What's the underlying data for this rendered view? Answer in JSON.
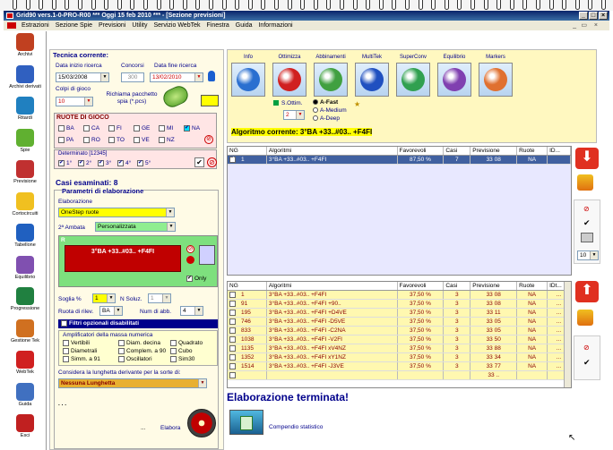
{
  "window": {
    "title": "Grid90 vers.1-0-PRO-R00  ***  Oggi 15 feb 2010  ***  - [Sezione previsioni]"
  },
  "menu": [
    "Estrazioni",
    "Sezione Spie",
    "Previsioni",
    "Utility",
    "Servizio WebTek",
    "Finestra",
    "Guida",
    "Informazioni"
  ],
  "sidebar": [
    {
      "label": "Archivi",
      "icon": "book-icon"
    },
    {
      "label": "Archivi derivati",
      "icon": "blue-book-icon"
    },
    {
      "label": "Ritardi",
      "icon": "clock-icon"
    },
    {
      "label": "Spie",
      "icon": "tube-icon"
    },
    {
      "label": "Previsione",
      "icon": "clipboard-icon"
    },
    {
      "label": "Cortocircuiti",
      "icon": "bulb-icon"
    },
    {
      "label": "Tabellone",
      "icon": "calendar-icon"
    },
    {
      "label": "Equilibrio",
      "icon": "scale-icon"
    },
    {
      "label": "Progressione",
      "icon": "dollar-icon"
    },
    {
      "label": "Gestione Tek",
      "icon": "gear-icon"
    },
    {
      "label": "WebTek",
      "icon": "webtek-icon"
    },
    {
      "label": "Guida",
      "icon": "help-book-icon"
    },
    {
      "label": "Esci",
      "icon": "exit-icon"
    }
  ],
  "left": {
    "tecnica": "Tecnica corrente:",
    "data_inizio_label": "Data inizio ricerca",
    "data_inizio": "15/03/2008",
    "concorsi_label": "Concorsi",
    "concorsi": "300",
    "data_fine_label": "Data fine ricerca",
    "data_fine": "13/02/2010",
    "colpi_label": "Colpi di gioco",
    "colpi": "10",
    "richiama_label": "Richiama pacchetto spia (*.pcs)",
    "ruote_title": "RUOTE DI GIOCO",
    "ruote_row1": [
      "BA",
      "CA",
      "FI",
      "GE",
      "MI",
      "NA"
    ],
    "ruote_row2": [
      "PA",
      "RO",
      "TO",
      "VE",
      "NZ"
    ],
    "determinato_label": "Determinato [12345]",
    "determinato": [
      "1°",
      "2°",
      "3°",
      "4°",
      "5°"
    ],
    "casi_esaminati": "Casi esaminati: 8",
    "parametri_title": "Parametri di elaborazione",
    "elaborazione_label": "Elaborazione",
    "elaborazione": "OneStep ruote",
    "ambata_label": "2ª Ambata",
    "ambata": "Personalizzata",
    "r_label": "R",
    "algoritmo_box": "3°BA +33..#03.. +F4FI",
    "only_label": "Only",
    "soglia_label": "Soglia %",
    "soglia": "1",
    "nsoluz_label": "N Soluz.",
    "nsoluz": "1",
    "ruota_rilev_label": "Ruota di rilev.",
    "ruota_rilev": "BA",
    "num_abb_label": "Num di abb.",
    "num_abb": "4",
    "filtri_label": "Filtri opzionali disabilitati",
    "amplificatori_title": "Amplificatori della massa numerica",
    "amplificatori": [
      "Vertibili",
      "Diam. decina",
      "Quadrato",
      "Diametrali",
      "Complem. a 90",
      "Cubo",
      "Simm. a 91",
      "Oscillatori",
      "Sim30"
    ],
    "lunghetta_label": "Considera la lunghetta derivante per la sorte di:",
    "lunghetta": "Nessuna Lunghetta",
    "dots": ". . .",
    "ellipsis": "...",
    "elabora_label": "Elabora"
  },
  "toolbar": {
    "buttons": [
      {
        "label": "Info",
        "icon": "question-icon",
        "color": "#2a6fd0"
      },
      {
        "label": "Ottimizza",
        "icon": "refresh-icon",
        "color": "#d02020"
      },
      {
        "label": "Abbinamenti",
        "icon": "gear-icon",
        "color": "#40a040"
      },
      {
        "label": "MultiTek",
        "icon": "swirl-icon",
        "color": "#2050c0"
      },
      {
        "label": "SuperConv",
        "icon": "recycle-icon",
        "color": "#30a050"
      },
      {
        "label": "Equilibrio",
        "icon": "purple-swirl-icon",
        "color": "#8040b0"
      },
      {
        "label": "Markers",
        "icon": "basketball-icon",
        "color": "#e07030"
      }
    ],
    "sottim_label": "S.Ottim.",
    "sottim": "2",
    "radio": [
      "A-Fast",
      "A-Medium",
      "A-Deep"
    ],
    "algoritmo_corrente": "Algoritmo corrente: 3°BA +33..#03.. +F4FI"
  },
  "table_top": {
    "headers": [
      "NG",
      "Algoritmi",
      "Favorevoli",
      "Casi",
      "Previsione",
      "Ruote",
      "ID..."
    ],
    "rows": [
      {
        "n": "1",
        "alg": "3°BA +33..#03.. +F4FI",
        "fav": "87,50 %",
        "casi": "7",
        "prev": "33 08",
        "ruote": "NA",
        "id": ""
      }
    ]
  },
  "table_bottom": {
    "headers": [
      "NG",
      "Algoritmi",
      "Favorevoli",
      "Casi",
      "Previsione",
      "Ruote",
      "IDt..."
    ],
    "rows": [
      {
        "n": "1",
        "alg": "3°BA +33..#03.. +F4FI",
        "fav": "37,50 %",
        "casi": "3",
        "prev": "33 08",
        "ruote": "NA",
        "id": "..."
      },
      {
        "n": "91",
        "alg": "3°BA +33..#03.. +F4FI +90..",
        "fav": "37,50 %",
        "casi": "3",
        "prev": "33 08",
        "ruote": "NA",
        "id": "..."
      },
      {
        "n": "195",
        "alg": "3°BA +33..#03.. +F4FI +D4VE",
        "fav": "37,50 %",
        "casi": "3",
        "prev": "33 11",
        "ruote": "NA",
        "id": "..."
      },
      {
        "n": "746",
        "alg": "3°BA +33..#03.. +F4FI -D5VE",
        "fav": "37,50 %",
        "casi": "3",
        "prev": "33 05",
        "ruote": "NA",
        "id": "..."
      },
      {
        "n": "833",
        "alg": "3°BA +33..#03.. +F4FI -C2NA",
        "fav": "37,50 %",
        "casi": "3",
        "prev": "33 05",
        "ruote": "NA",
        "id": "..."
      },
      {
        "n": "1038",
        "alg": "3°BA +33..#03.. +F4FI -V2FI",
        "fav": "37,50 %",
        "casi": "3",
        "prev": "33 50",
        "ruote": "NA",
        "id": "..."
      },
      {
        "n": "1135",
        "alg": "3°BA +33..#03.. +F4FI xV4NZ",
        "fav": "37,50 %",
        "casi": "3",
        "prev": "33 88",
        "ruote": "NA",
        "id": "..."
      },
      {
        "n": "1352",
        "alg": "3°BA +33..#03.. +F4FI xY1NZ",
        "fav": "37,50 %",
        "casi": "3",
        "prev": "33 34",
        "ruote": "NA",
        "id": "..."
      },
      {
        "n": "1514",
        "alg": "3°BA +33..#03.. +F4FI -J3VE",
        "fav": "37,50 %",
        "casi": "3",
        "prev": "33 77",
        "ruote": "NA",
        "id": "..."
      },
      {
        "n": "",
        "alg": "",
        "fav": "",
        "casi": "",
        "prev": "33 ..",
        "ruote": "",
        "id": ""
      }
    ]
  },
  "status": {
    "message": "Elaborazione terminata!",
    "compendio": "Compendio statistico"
  },
  "right": {
    "spinner": "10"
  }
}
